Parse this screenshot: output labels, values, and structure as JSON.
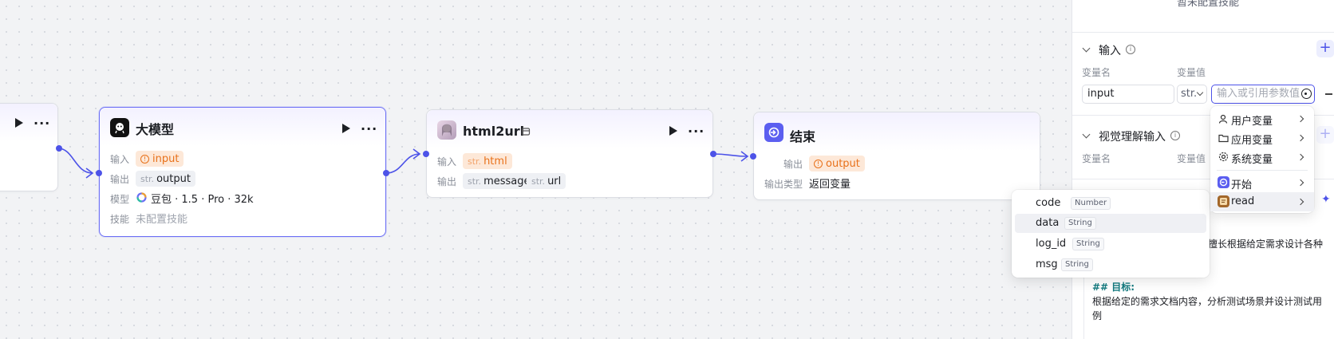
{
  "colors": {
    "accent": "#4d53e8",
    "warn": "#e8711a",
    "warn_bg": "#fde8d8",
    "edge": "#4d53e8"
  },
  "node_prev": {
    "actions": "···"
  },
  "node_llm": {
    "title": "大模型",
    "icon": "llm-icon",
    "actions": "···",
    "input_label": "输入",
    "input_value": "input",
    "output_label": "输出",
    "output_type": "str.",
    "output_value": "output",
    "model_label": "模型",
    "model_value": "豆包 · 1.5 · Pro · 32k",
    "skill_label": "技能",
    "skill_value": "未配置技能"
  },
  "node_html2url": {
    "title": "html2url",
    "actions": "···",
    "input_label": "输入",
    "input_type": "str.",
    "input_value": "html",
    "output_label": "输出",
    "outputs": [
      {
        "type": "str.",
        "name": "message"
      },
      {
        "type": "str.",
        "name": "url"
      }
    ]
  },
  "node_end": {
    "title": "结束",
    "output_label": "输出",
    "output_value": "output",
    "output_type_label": "输出类型",
    "output_type_value": "返回变量"
  },
  "panel": {
    "top_text": "暂未配置技能",
    "input_section": "输入",
    "col_name": "变量名",
    "col_value": "变量值",
    "row_name": "input",
    "row_type": "str.",
    "row_placeholder": "输入或引用参数值",
    "vision_section": "视觉理解输入",
    "col_name2": "变量名",
    "col_value2": "变量值",
    "prompt_partial": "擅长根据给定需求设计各种",
    "prompt_heading": "## 目标:",
    "prompt_line1": "根据给定的需求文档内容，分析测试场景并设计测试用",
    "prompt_line2": "例"
  },
  "ref_menu": {
    "items": [
      {
        "label": "用户变量",
        "icon": "user-icon"
      },
      {
        "label": "应用变量",
        "icon": "folder-icon"
      },
      {
        "label": "系统变量",
        "icon": "gear-icon"
      },
      {
        "label": "开始",
        "icon": "start-node-icon"
      },
      {
        "label": "read",
        "icon": "plugin-icon"
      }
    ]
  },
  "fields_menu": {
    "items": [
      {
        "name": "code",
        "type": "Number"
      },
      {
        "name": "data",
        "type": "String"
      },
      {
        "name": "log_id",
        "type": "String"
      },
      {
        "name": "msg",
        "type": "String"
      }
    ]
  }
}
